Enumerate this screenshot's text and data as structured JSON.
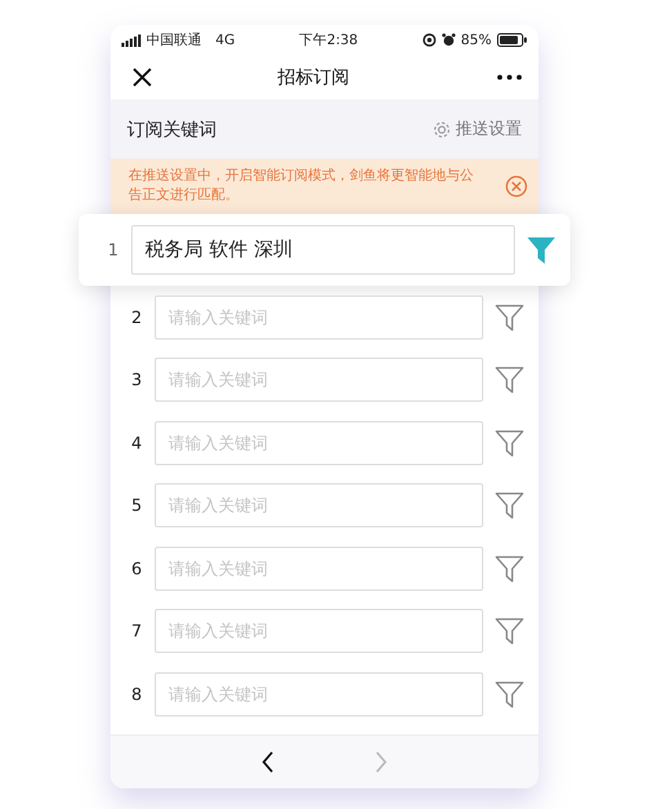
{
  "status_bar": {
    "carrier": "中国联通",
    "network": "4G",
    "time": "下午2:38",
    "battery": "85%"
  },
  "nav": {
    "title": "招标订阅"
  },
  "section": {
    "title": "订阅关键词",
    "settings_label": "推送设置"
  },
  "banner": {
    "text": "在推送设置中，开启智能订阅模式，剑鱼将更智能地与公告正文进行匹配。"
  },
  "keywords": [
    {
      "number": "1",
      "value": "税务局 软件 深圳",
      "highlighted": true
    },
    {
      "number": "2",
      "placeholder": "请输入关键词",
      "highlighted": false
    },
    {
      "number": "3",
      "placeholder": "请输入关键词",
      "highlighted": false
    },
    {
      "number": "4",
      "placeholder": "请输入关键词",
      "highlighted": false
    },
    {
      "number": "5",
      "placeholder": "请输入关键词",
      "highlighted": false
    },
    {
      "number": "6",
      "placeholder": "请输入关键词",
      "highlighted": false
    },
    {
      "number": "7",
      "placeholder": "请输入关键词",
      "highlighted": false
    },
    {
      "number": "8",
      "placeholder": "请输入关键词",
      "highlighted": false
    }
  ],
  "pager": {
    "back_disabled": false,
    "forward_disabled": true
  }
}
